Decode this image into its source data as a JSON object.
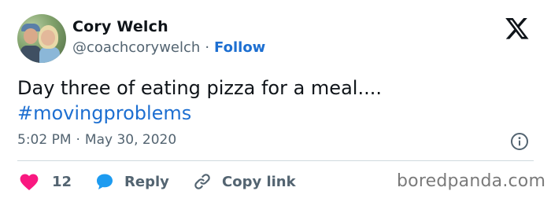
{
  "author": {
    "name": "Cory Welch",
    "handle": "@coachcorywelch",
    "separator": "·",
    "follow_label": "Follow"
  },
  "tweet": {
    "text": "Day three of eating pizza for a meal....",
    "hashtag": "#movingproblems",
    "time": "5:02 PM",
    "separator": "·",
    "date": "May 30, 2020"
  },
  "actions": {
    "like_count": "12",
    "reply_label": "Reply",
    "copy_link_label": "Copy link"
  },
  "watermark": "boredpanda.com",
  "colors": {
    "link": "#1d6fd1",
    "heart": "#f91880",
    "reply_bubble": "#1d9bf0",
    "secondary_text": "#536471"
  },
  "icons": [
    "x-logo-icon",
    "info-icon",
    "heart-icon",
    "reply-bubble-icon",
    "link-icon"
  ]
}
